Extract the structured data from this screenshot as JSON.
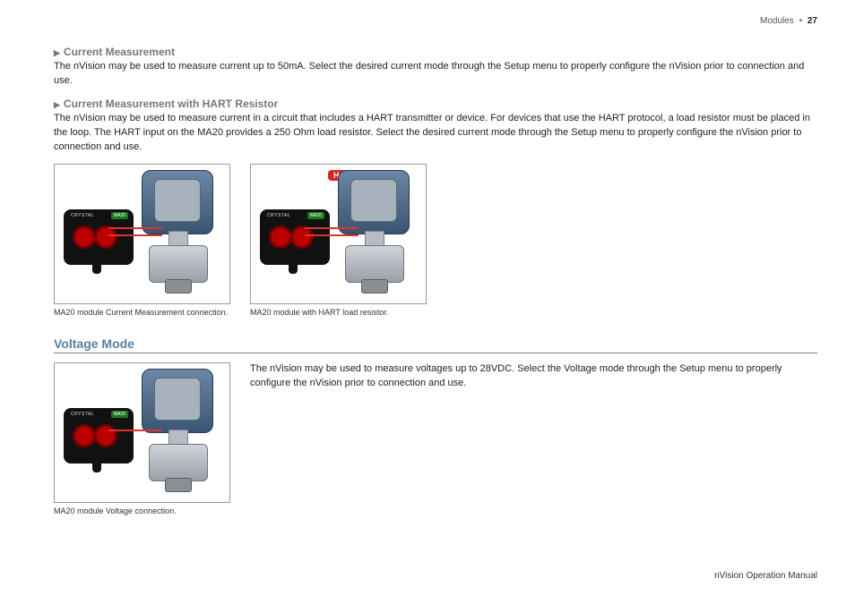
{
  "header": {
    "section": "Modules",
    "page": "27"
  },
  "sections": {
    "s1": {
      "title": "Current Measurement",
      "body": "The nVision may be used to measure current up to 50mA. Select the desired current mode through the Setup menu to properly configure the nVision prior to connection and use."
    },
    "s2": {
      "title": "Current Measurement with HART Resistor",
      "body": "The nVision may be used to measure current in a circuit that includes a HART transmitter or device. For devices that use the HART protocol, a load resistor must be placed in the loop. The HART input on the MA20 provides a 250 Ohm load resistor. Select the desired current mode through the Setup menu to properly configure the nVision prior to connection and use."
    },
    "voltage": {
      "title": "Voltage Mode",
      "body": "The nVision may be used to measure voltages up to 28VDC. Select the Voltage mode through the Setup menu to properly configure the nVision prior to connection and use."
    }
  },
  "figures": {
    "f1": {
      "module_label": "CRYSTAL",
      "module_chip": "MA20",
      "caption": "MA20 module Current Measurement connection."
    },
    "f2": {
      "module_label": "CRYSTAL",
      "module_chip": "MA20",
      "hart": "HART",
      "caption": "MA20 module with HART load resistor."
    },
    "f3": {
      "module_label": "CRYSTAL",
      "module_chip": "MA20",
      "caption": "MA20 module Voltage connection."
    }
  },
  "footer": "nVision Operation Manual"
}
